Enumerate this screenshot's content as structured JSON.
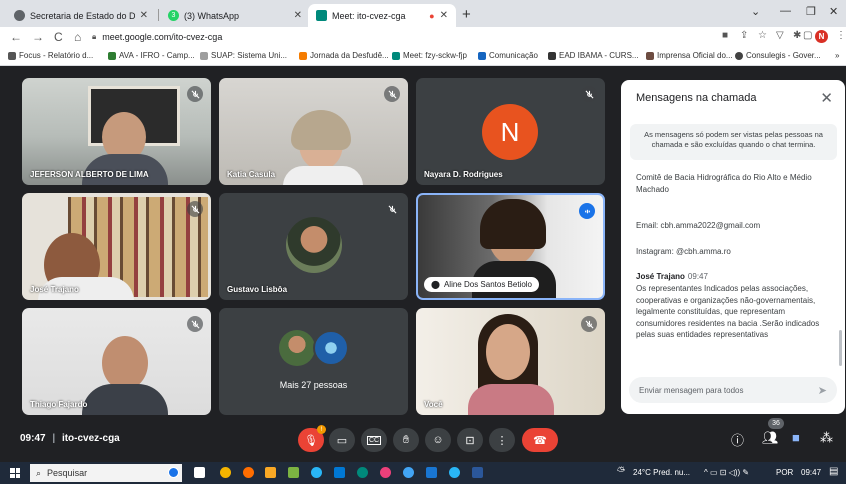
{
  "browser": {
    "tabs": [
      {
        "title": "Secretaria de Estado do Desenvo",
        "color": "#5f6368",
        "glyph": "◉"
      },
      {
        "title": "(3) WhatsApp",
        "color": "#25d366",
        "glyph": "3"
      },
      {
        "title": "Meet: ito-cvez-cga",
        "color": "#00897b",
        "glyph": "▶"
      }
    ],
    "url": "meet.google.com/ito-cvez-cga",
    "profile_initial": "N",
    "bookmarks": [
      "Focus - Relatório d...",
      "AVA - IFRO - Camp...",
      "SUAP: Sistema Uni...",
      "Jornada da Desfudê...",
      "Meet: fzy-sckw-fjp",
      "Comunicação",
      "EAD IBAMA - CURS...",
      "Imprensa Oficial do...",
      "Consulegis - Gover..."
    ]
  },
  "participants": [
    {
      "name": "JEFERSON ALBERTO DE LIMA"
    },
    {
      "name": "Katia Casula"
    },
    {
      "name": "Nayara D. Rodrigues",
      "initial": "N",
      "avatar_color": "#e8531f"
    },
    {
      "name": "José Trajano"
    },
    {
      "name": "Gustavo Lisbôa"
    },
    {
      "name": "Aline Dos Santos Betiolo"
    },
    {
      "name": "Thiago Fajardo"
    },
    {
      "name": "Mais 27 pessoas"
    },
    {
      "name": "Você"
    }
  ],
  "chat": {
    "title": "Mensagens na chamada",
    "notice": "As mensagens só podem ser vistas pelas pessoas na chamada e são excluídas quando o chat termina.",
    "line1": "Comitê de Bacia Hidrográfica do Rio Alto e Médio Machado",
    "email": "Email: cbh.amma2022@gmail.com",
    "instagram": "Instagram: @cbh.amma.ro",
    "sender": "José Trajano",
    "time": "09:47",
    "message": "Os representantes Indicados pelas associações, cooperativas e organizações não-governamentais, legalmente constituídas, que representam consumidores residentes na bacia .Serão indicados pelas suas entidades representativas",
    "input_placeholder": "Enviar mensagem para todos"
  },
  "meeting": {
    "time": "09:47",
    "code": "ito-cvez-cga",
    "people_count": "36"
  },
  "taskbar": {
    "search_placeholder": "Pesquisar",
    "weather": "24°C  Pred. nu...",
    "lang": "POR",
    "clock": "09:47"
  }
}
